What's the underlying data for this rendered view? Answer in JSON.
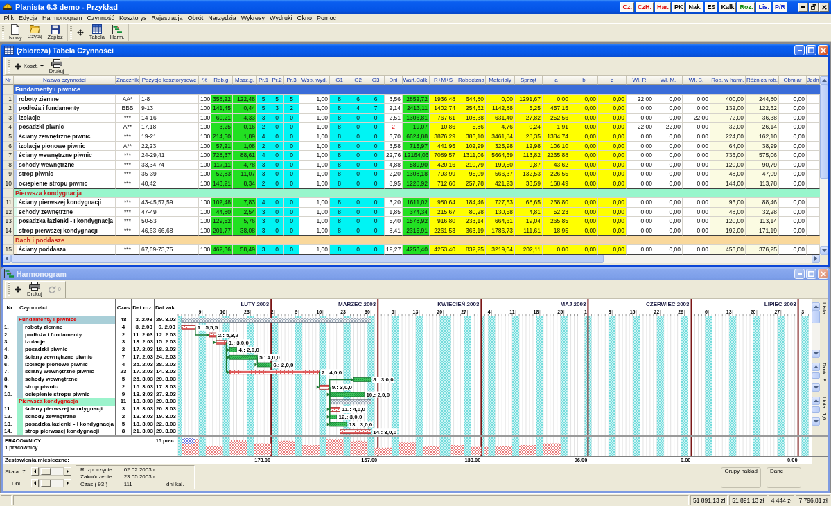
{
  "app": {
    "title": "Planista 6.3 demo - Przykład",
    "quick_buttons": [
      {
        "label": "Cz.",
        "color": "#e01010"
      },
      {
        "label": "CzH.",
        "color": "#e01010"
      },
      {
        "label": "Har.",
        "color": "#e01010"
      },
      {
        "label": "PK",
        "color": "#000000"
      },
      {
        "label": "Nak.",
        "color": "#000000"
      },
      {
        "label": "ES",
        "color": "#000000"
      },
      {
        "label": "Kalk",
        "color": "#000000"
      },
      {
        "label": "Roz.",
        "color": "#0a8a0a"
      },
      {
        "label": "Lis.",
        "color": "#1028d0"
      },
      {
        "label": "P/R",
        "color": "#1028d0"
      }
    ]
  },
  "menu": [
    "Plik",
    "Edycja",
    "Harmonogram",
    "Czynność",
    "Kosztorys",
    "Rejestracja",
    "Obrót",
    "Narzędzia",
    "Wykresy",
    "Wydruki",
    "Okno",
    "Pomoc"
  ],
  "toolbar": [
    {
      "buttons": [
        {
          "kind": "new",
          "label": "Nowy"
        },
        {
          "kind": "open",
          "label": "Czytaj"
        },
        {
          "kind": "save",
          "label": "Zapisz"
        }
      ]
    },
    {
      "buttons": [
        {
          "kind": "move"
        },
        {
          "kind": "table",
          "label": "Tabela"
        },
        {
          "kind": "gantt",
          "label": "Harm."
        }
      ]
    }
  ],
  "table_window": {
    "title": "(zbiorcza) Tabela Czynności",
    "active": true,
    "toolbar": [
      {
        "kind": "move",
        "label": "Koszt.",
        "dropdown": true,
        "disabled": false
      },
      {
        "kind": "print",
        "label": "Drukuj",
        "dropdown": false,
        "disabled": false
      }
    ],
    "columns": [
      {
        "label": "Nr"
      },
      {
        "label": "Nazwa czynności"
      },
      {
        "label": "Znacznik"
      },
      {
        "label": "Pozycje kosztorysowe"
      },
      {
        "label": "%"
      },
      {
        "label": "Rob.g.",
        "color": "#22e022"
      },
      {
        "label": "Masz.g.",
        "color": "#22e022"
      },
      {
        "label": "Pr.1",
        "color": "#00f4f4"
      },
      {
        "label": "Pr.2",
        "color": "#00f4f4"
      },
      {
        "label": "Pr.3",
        "color": "#00f4f4"
      },
      {
        "label": "Wsp. wyd."
      },
      {
        "label": "G1",
        "color": "#00f4f4"
      },
      {
        "label": "G2",
        "color": "#00f4f4"
      },
      {
        "label": "G3",
        "color": "#00f4f4"
      },
      {
        "label": "Dni"
      },
      {
        "label": "Wart.Całk.",
        "color": "#22e022"
      },
      {
        "label": "R+M+S",
        "color": "#ffff00"
      },
      {
        "label": "Robocizna",
        "color": "#ffff00"
      },
      {
        "label": "Materiały",
        "color": "#ffff00"
      },
      {
        "label": "Sprzęt",
        "color": "#ffff00"
      },
      {
        "label": "a",
        "color": "#ffff00"
      },
      {
        "label": "b",
        "color": "#ffff00"
      },
      {
        "label": "c",
        "color": "#ffff00"
      },
      {
        "label": "Wł. R."
      },
      {
        "label": "Wł. M."
      },
      {
        "label": "Wł. S."
      },
      {
        "label": "Rob. w harm.",
        "color": "#fbfbe2"
      },
      {
        "label": "Różnica rob.",
        "color": "#fbfbe2"
      },
      {
        "label": "Obmiar"
      },
      {
        "label": "Jedn"
      }
    ],
    "groups": [
      {
        "name": "Fundamenty i piwnice",
        "color": "#3a6cd8",
        "rows": [
          {
            "dni_highlighted": false,
            "cells": [
              "1",
              "roboty ziemne",
              "AA*",
              "1-8",
              "100",
              "358,22",
              "122,48",
              "5",
              "5",
              "5",
              "1,00",
              "8",
              "6",
              "6",
              "3,56",
              "2852,72",
              "1936,48",
              "644,80",
              "0,00",
              "1291,67",
              "0,00",
              "0,00",
              "0,00",
              "22,00",
              "0,00",
              "0,00",
              "400,00",
              "244,80",
              "0,00"
            ]
          },
          {
            "dni_highlighted": false,
            "cells": [
              "2",
              "podłoża i fundamenty",
              "BBB",
              "9-13",
              "100",
              "141,45",
              "0,44",
              "5",
              "3",
              "2",
              "1,00",
              "8",
              "4",
              "7",
              "2,14",
              "2413,11",
              "1402,74",
              "254,62",
              "1142,88",
              "5,25",
              "457,15",
              "0,00",
              "0,00",
              "0,00",
              "0,00",
              "0,00",
              "132,00",
              "122,62",
              "0,00"
            ]
          },
          {
            "dni_highlighted": false,
            "cells": [
              "3",
              "izolacje",
              "***",
              "14-16",
              "100",
              "60,21",
              "4,33",
              "3",
              "0",
              "0",
              "1,00",
              "8",
              "0",
              "0",
              "2,51",
              "1306,81",
              "767,61",
              "108,38",
              "631,40",
              "27,82",
              "252,56",
              "0,00",
              "0,00",
              "0,00",
              "0,00",
              "22,00",
              "72,00",
              "36,38",
              "0,00"
            ]
          },
          {
            "dni_highlighted": true,
            "cells": [
              "4",
              "posadzki piwnic",
              "A**",
              "17,18",
              "100",
              "3,25",
              "0,16",
              "2",
              "0",
              "0",
              "1,00",
              "8",
              "0",
              "0",
              "2",
              "19,07",
              "10,86",
              "5,86",
              "4,76",
              "0,24",
              "1,91",
              "0,00",
              "0,00",
              "22,00",
              "22,00",
              "0,00",
              "32,00",
              "-26,14",
              "0,00"
            ]
          },
          {
            "dni_highlighted": false,
            "cells": [
              "5",
              "ściany zewnętrzne piwnic",
              "***",
              "19-21",
              "100",
              "214,50",
              "1,89",
              "4",
              "0",
              "0",
              "1,00",
              "8",
              "0",
              "0",
              "6,70",
              "6624,88",
              "3876,29",
              "386,10",
              "3461,84",
              "28,35",
              "1384,74",
              "0,00",
              "0,00",
              "0,00",
              "0,00",
              "0,00",
              "224,00",
              "162,10",
              "0,00"
            ]
          },
          {
            "dni_highlighted": false,
            "cells": [
              "6",
              "izolacje pionowe piwnic",
              "A**",
              "22,23",
              "100",
              "57,21",
              "1,08",
              "2",
              "0",
              "0",
              "1,00",
              "8",
              "0",
              "0",
              "3,58",
              "715,97",
              "441,95",
              "102,99",
              "325,98",
              "12,98",
              "106,10",
              "0,00",
              "0,00",
              "0,00",
              "0,00",
              "0,00",
              "64,00",
              "38,99",
              "0,00"
            ]
          },
          {
            "dni_highlighted": false,
            "cells": [
              "7",
              "ściany wewnętrzne piwnic",
              "***",
              "24-29,41",
              "100",
              "728,37",
              "88,61",
              "4",
              "0",
              "0",
              "1,00",
              "8",
              "0",
              "0",
              "22,76",
              "12164,06",
              "7089,57",
              "1311,06",
              "5664,69",
              "113,82",
              "2265,88",
              "0,00",
              "0,00",
              "0,00",
              "0,00",
              "0,00",
              "736,00",
              "575,06",
              "0,00"
            ]
          },
          {
            "dni_highlighted": false,
            "cells": [
              "8",
              "schody wewnętrzne",
              "***",
              "33,34,74",
              "100",
              "117,11",
              "4,78",
              "3",
              "0",
              "0",
              "1,00",
              "8",
              "0",
              "0",
              "4,88",
              "589,90",
              "420,16",
              "210,79",
              "199,50",
              "9,87",
              "43,62",
              "0,00",
              "0,00",
              "0,00",
              "0,00",
              "0,00",
              "120,00",
              "90,79",
              "0,00"
            ]
          },
          {
            "dni_highlighted": false,
            "cells": [
              "9",
              "strop piwnic",
              "***",
              "35-39",
              "100",
              "52,83",
              "11,07",
              "3",
              "0",
              "0",
              "1,00",
              "8",
              "0",
              "0",
              "2,20",
              "1308,18",
              "793,99",
              "95,09",
              "566,37",
              "132,53",
              "226,55",
              "0,00",
              "0,00",
              "0,00",
              "0,00",
              "0,00",
              "48,00",
              "47,09",
              "0,00"
            ]
          },
          {
            "dni_highlighted": false,
            "cells": [
              "10",
              "ocieplenie stropu piwnic",
              "***",
              "40,42",
              "100",
              "143,21",
              "8,34",
              "2",
              "0",
              "0",
              "1,00",
              "8",
              "0",
              "0",
              "8,95",
              "1228,92",
              "712,60",
              "257,78",
              "421,23",
              "33,59",
              "168,49",
              "0,00",
              "0,00",
              "0,00",
              "0,00",
              "0,00",
              "144,00",
              "113,78",
              "0,00"
            ]
          }
        ]
      },
      {
        "name": "Pierwsza kondygnacja",
        "color": "#98f6cc",
        "rows": [
          {
            "dni_highlighted": false,
            "cells": [
              "11",
              "ściany pierwszej kondygnacji",
              "***",
              "43-45,57,59",
              "100",
              "102,48",
              "7,83",
              "4",
              "0",
              "0",
              "1,00",
              "8",
              "0",
              "0",
              "3,20",
              "1611,02",
              "980,64",
              "184,46",
              "727,53",
              "68,65",
              "268,80",
              "0,00",
              "0,00",
              "0,00",
              "0,00",
              "0,00",
              "96,00",
              "88,46",
              "0,00"
            ]
          },
          {
            "dni_highlighted": false,
            "cells": [
              "12",
              "schody zewnętrzne",
              "***",
              "47-49",
              "100",
              "44,80",
              "2,54",
              "3",
              "0",
              "0",
              "1,00",
              "8",
              "0",
              "0",
              "1,85",
              "374,34",
              "215,67",
              "80,28",
              "130,58",
              "4,81",
              "52,23",
              "0,00",
              "0,00",
              "0,00",
              "0,00",
              "0,00",
              "48,00",
              "32,28",
              "0,00"
            ]
          },
          {
            "dni_highlighted": false,
            "cells": [
              "13",
              "posadzka łazienki - I kondygnacja",
              "***",
              "50-53",
              "100",
              "129,52",
              "5,76",
              "3",
              "0",
              "0",
              "1,00",
              "8",
              "0",
              "0",
              "5,40",
              "1578,92",
              "916,80",
              "233,14",
              "664,61",
              "19,04",
              "265,85",
              "0,00",
              "0,00",
              "0,00",
              "0,00",
              "0,00",
              "120,00",
              "113,14",
              "0,00"
            ]
          },
          {
            "dni_highlighted": false,
            "cells": [
              "14",
              "strop pierwszej kondygnacji",
              "***",
              "46,63-66,68",
              "100",
              "201,77",
              "38,08",
              "3",
              "0",
              "0",
              "1,00",
              "8",
              "0",
              "0",
              "8,41",
              "2315,91",
              "2261,53",
              "363,19",
              "1786,73",
              "111,61",
              "18,95",
              "0,00",
              "0,00",
              "0,00",
              "0,00",
              "0,00",
              "192,00",
              "171,19",
              "0,00"
            ]
          }
        ]
      },
      {
        "name": "Dach i poddasze",
        "color": "#f9d89c",
        "rows": [
          {
            "dni_highlighted": false,
            "cells": [
              "15",
              "ściany poddasza",
              "***",
              "67,69-73,75",
              "100",
              "462,36",
              "58,49",
              "3",
              "0",
              "0",
              "1,00",
              "8",
              "0",
              "0",
              "19,27",
              "4253,40",
              "4253,40",
              "832,25",
              "3219,04",
              "202,11",
              "0,00",
              "0,00",
              "0,00",
              "0,00",
              "0,00",
              "0,00",
              "456,00",
              "376,25",
              "0,00"
            ]
          }
        ]
      }
    ]
  },
  "harmonogram_window": {
    "title": "Harmonogram",
    "active": false,
    "toolbar": [
      {
        "kind": "move",
        "disabled": false
      },
      {
        "kind": "print",
        "label": "Drukuj",
        "disabled": false
      },
      {
        "kind": "undo",
        "label": "0",
        "disabled": true
      }
    ],
    "columns": [
      "Nr",
      "Czynności",
      "Czas",
      "Dat.roz.",
      "Dat.zak."
    ],
    "months": [
      "LUTY 2003",
      "MARZEC 2003",
      "KWIECIEŃ 2003",
      "MAJ 2003",
      "CZERWIEC 2003",
      "LIPIEC 2003"
    ],
    "day_ticks": [
      "9",
      "16",
      "23",
      "2",
      "9",
      "16",
      "23",
      "30",
      "6",
      "13",
      "20",
      "27",
      "4",
      "11",
      "18",
      "25",
      "1",
      "8",
      "15",
      "22",
      "29",
      "6",
      "13",
      "20",
      "27",
      "3"
    ],
    "groups": [
      {
        "name": "Fundamenty i piwnice",
        "color": "#a9cfd8",
        "czas": "48",
        "start": "3. 2.03",
        "end": "29. 3.03",
        "tasks": [
          {
            "nr": "1.",
            "name": "roboty ziemne",
            "czas": "4",
            "start": "3. 2.03",
            "end": "6. 2.03",
            "critical": true,
            "bar_label": "1.: 5,5,5"
          },
          {
            "nr": "2.",
            "name": "podłoża i fundamenty",
            "czas": "2",
            "start": "11. 2.03",
            "end": "12. 2.03",
            "critical": true,
            "bar_label": "2.: 5,3,2"
          },
          {
            "nr": "3.",
            "name": "izolacje",
            "czas": "3",
            "start": "13. 2.03",
            "end": "15. 2.03",
            "critical": true,
            "bar_label": "3.: 3,0,0"
          },
          {
            "nr": "4.",
            "name": "posadzki piwnic",
            "czas": "2",
            "start": "17. 2.03",
            "end": "18. 2.03",
            "critical": false,
            "bar_label": "4.: 2,0,0"
          },
          {
            "nr": "5.",
            "name": "ściany zewnętrzne piwnic",
            "czas": "7",
            "start": "17. 2.03",
            "end": "24. 2.03",
            "critical": false,
            "bar_label": "5.: 4,0,0"
          },
          {
            "nr": "6.",
            "name": "izolacje pionowe piwnic",
            "czas": "4",
            "start": "25. 2.03",
            "end": "28. 2.03",
            "critical": false,
            "bar_label": "6.: 2,0,0"
          },
          {
            "nr": "7.",
            "name": "ściany wewnętrzne piwnic",
            "czas": "23",
            "start": "17. 2.03",
            "end": "14. 3.03",
            "critical": true,
            "bar_label": "7.: 4,0,0"
          },
          {
            "nr": "8.",
            "name": "schody wewnętrzne",
            "czas": "5",
            "start": "25. 3.03",
            "end": "29. 3.03",
            "critical": false,
            "bar_label": "8.: 3,0,0"
          },
          {
            "nr": "9.",
            "name": "strop piwnic",
            "czas": "2",
            "start": "15. 3.03",
            "end": "17. 3.03",
            "critical": true,
            "bar_label": "9.: 3,0,0"
          },
          {
            "nr": "10.",
            "name": "ocieplenie stropu piwnic",
            "czas": "9",
            "start": "18. 3.03",
            "end": "27. 3.03",
            "critical": false,
            "bar_label": "10.: 2,0,0"
          }
        ]
      },
      {
        "name": "Pierwsza kondygnacja",
        "color": "#9cf3cc",
        "czas": "11",
        "start": "18. 3.03",
        "end": "29. 3.03",
        "tasks": [
          {
            "nr": "11.",
            "name": "ściany pierwszej kondygnacji",
            "czas": "3",
            "start": "18. 3.03",
            "end": "20. 3.03",
            "critical": true,
            "bar_label": "11.: 4,0,0"
          },
          {
            "nr": "12.",
            "name": "schody zewnętrzne",
            "czas": "2",
            "start": "18. 3.03",
            "end": "19. 3.03",
            "critical": false,
            "bar_label": "12.: 3,0,0"
          },
          {
            "nr": "13.",
            "name": "posadzka łazienki - I kondygnacja",
            "czas": "5",
            "start": "18. 3.03",
            "end": "22. 3.03",
            "critical": false,
            "bar_label": "13.: 3,0,0"
          },
          {
            "nr": "14.",
            "name": "strop pierwszej kondygnacji",
            "czas": "8",
            "start": "21. 3.03",
            "end": "29. 3.03",
            "critical": true,
            "bar_label": "14.: 3,0,0"
          }
        ]
      }
    ],
    "side_controls": [
      {
        "label": "Lista"
      },
      {
        "label": "Druk",
        "value": "8"
      },
      {
        "label": "Linia",
        "value": "1,6"
      }
    ],
    "resources": {
      "title": "PRACOWNICY",
      "name": "1.pracownicy",
      "count": "15 prac."
    },
    "monthly": {
      "label": "Zestawienia miesieczne:",
      "values": [
        "173.00",
        "167.00",
        "133.00",
        "96.00",
        "0.00",
        "0.00"
      ]
    },
    "scale": {
      "label": "Skala:",
      "value": "7",
      "level": 0.1
    },
    "days": {
      "label": "Dni",
      "level": 0.1
    },
    "info": [
      {
        "label": "Rozpoczęcie:",
        "value": "02.02.2003 r."
      },
      {
        "label": "Zakończenie:",
        "value": "23.05.2003 r."
      },
      {
        "label": "Czas ( 93 )",
        "value": "111",
        "unit": "dni kal."
      }
    ],
    "panels": [
      "Grupy nakład",
      "Dane"
    ]
  },
  "status_bar": [
    "51 891,13 zł",
    "51 891,13 zł",
    "4 444 zł",
    "7 796,81 zł"
  ]
}
